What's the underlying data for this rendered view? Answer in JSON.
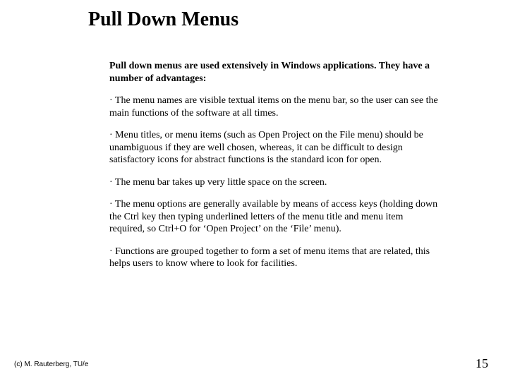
{
  "title": "Pull Down Menus",
  "intro": "Pull down menus are used extensively in Windows applications. They have a number of advantages:",
  "bullets": [
    "The menu names are visible textual items on the menu bar, so the user can see the main functions of the software at all times.",
    "Menu titles, or menu items (such as Open Project on the File menu) should be unambiguous if they are well chosen, whereas, it can be difficult to design satisfactory icons for abstract functions is the standard icon for open.",
    "The menu bar takes up very little space on the screen.",
    "The menu options are generally available by means of access keys (holding down the Ctrl key then typing underlined letters of the menu title and menu item required, so Ctrl+O for ‘Open Project’ on the ‘File’ menu).",
    "Functions are grouped together to form a set of menu items that are related, this helps users to know where to look for facilities."
  ],
  "footer_left": "(c) M. Rauterberg, TU/e",
  "page_number": "15",
  "bullet_char": "·"
}
